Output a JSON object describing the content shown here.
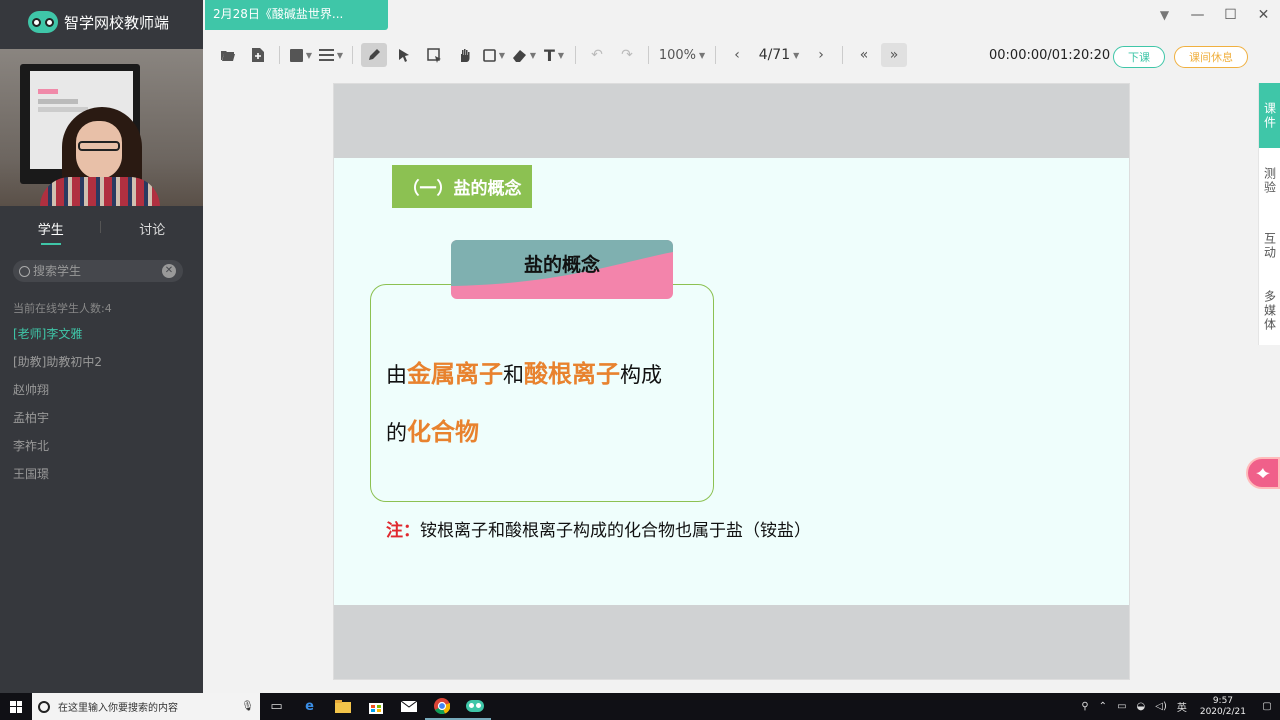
{
  "app": {
    "name": "智学网校教师端",
    "doc_tab": "2月28日《酸碱盐世界..."
  },
  "window_controls": {
    "dropdown": "▼",
    "minimize": "—",
    "maximize": "☐",
    "close": "✕"
  },
  "sidebar": {
    "tabs": [
      {
        "label": "学生",
        "active": true
      },
      {
        "label": "讨论",
        "active": false
      }
    ],
    "search": {
      "placeholder": "搜索学生",
      "value": ""
    },
    "online_count": "当前在线学生人数:4",
    "members": [
      {
        "name": "[老师]李文雅",
        "role": "teacher"
      },
      {
        "name": "[助教]助教初中2",
        "role": "assistant"
      },
      {
        "name": "赵帅翔",
        "role": "student"
      },
      {
        "name": "孟柏宇",
        "role": "student"
      },
      {
        "name": "李祚北",
        "role": "student"
      },
      {
        "name": "王国璟",
        "role": "student"
      }
    ]
  },
  "toolbar": {
    "zoom": "100%",
    "page": "4/71",
    "timer": "00:00:00/01:20:20",
    "end_class": "下课",
    "break": "课间休息",
    "icons": [
      "folder-open-icon",
      "new-page-icon",
      "fill-color-icon",
      "line-style-icon",
      "pen-icon",
      "pointer-icon",
      "select-icon",
      "hand-icon",
      "shape-icon",
      "eraser-icon",
      "text-icon",
      "undo-icon",
      "redo-icon"
    ]
  },
  "slide": {
    "section_title": "（一）盐的概念",
    "concept_header": "盐的概念",
    "line1": {
      "p1": "由",
      "h1": "金属离子",
      "p2": "和",
      "h2": "酸根离子",
      "p3": "构成"
    },
    "line2": {
      "p1": "的",
      "h1": "化合物"
    },
    "note": {
      "label": "注：",
      "text": "铵根离子和酸根离子构成的化合物也属于盐（铵盐）"
    }
  },
  "right_tabs": [
    {
      "label": "课件",
      "active": true
    },
    {
      "label": "测验",
      "active": false
    },
    {
      "label": "互动",
      "active": false
    },
    {
      "label": "多媒体",
      "active": false
    }
  ],
  "taskbar": {
    "search_placeholder": "在这里输入你要搜索的内容",
    "ime": "英",
    "time": "9:57",
    "date": "2020/2/21"
  },
  "colors": {
    "accent": "#3fc6a8",
    "section_green": "#8cc152",
    "highlight_orange": "#e8822e",
    "note_red": "#e0282e",
    "header_pink": "#f384ab",
    "header_teal": "#7fb0b0",
    "break_orange": "#f0b040"
  }
}
